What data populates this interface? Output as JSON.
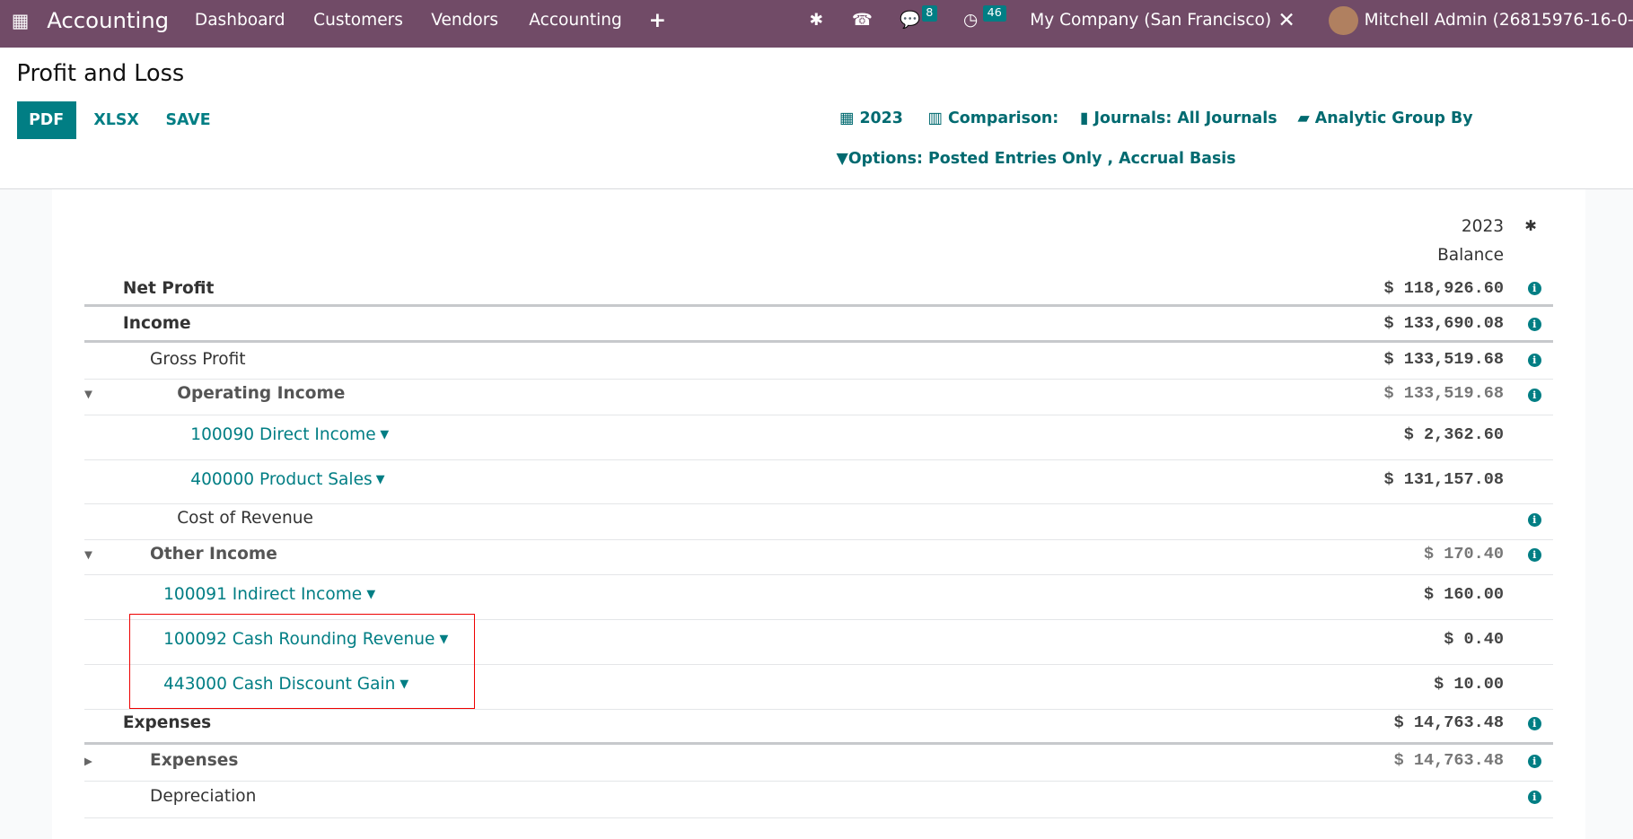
{
  "navbar": {
    "app_name": "Accounting",
    "menu": [
      "Dashboard",
      "Customers",
      "Vendors",
      "Accounting"
    ],
    "plus": "+",
    "messages_count": "8",
    "activities_count": "46",
    "company": "My Company (San Francisco)",
    "user": "Mitchell Admin (26815976-16-0-al"
  },
  "control_panel": {
    "title": "Profit and Loss",
    "buttons": {
      "pdf": "PDF",
      "xlsx": "XLSX",
      "save": "SAVE"
    },
    "filters": {
      "date": "2023",
      "comparison": "Comparison:",
      "journals": "Journals: All Journals",
      "analytic": "Analytic Group By",
      "options": "Options: Posted Entries Only , Accrual Basis"
    }
  },
  "report": {
    "column_year": "2023",
    "column_label": "Balance",
    "rows": [
      {
        "label": "Net Profit",
        "amount": "$ 118,926.60"
      },
      {
        "label": "Income",
        "amount": "$ 133,690.08"
      },
      {
        "label": "Gross Profit",
        "amount": "$ 133,519.68"
      },
      {
        "label": "Operating Income",
        "amount": "$ 133,519.68"
      },
      {
        "label": "100090 Direct Income",
        "amount": "$ 2,362.60"
      },
      {
        "label": "400000 Product Sales",
        "amount": "$ 131,157.08"
      },
      {
        "label": "Cost of Revenue",
        "amount": ""
      },
      {
        "label": "Other Income",
        "amount": "$ 170.40"
      },
      {
        "label": "100091 Indirect Income",
        "amount": "$ 160.00"
      },
      {
        "label": "100092 Cash Rounding Revenue",
        "amount": "$ 0.40"
      },
      {
        "label": "443000 Cash Discount Gain",
        "amount": "$ 10.00"
      },
      {
        "label": "Expenses",
        "amount": "$ 14,763.48"
      },
      {
        "label": "Expenses",
        "amount": "$ 14,763.48"
      },
      {
        "label": "Depreciation",
        "amount": ""
      }
    ]
  },
  "colors": {
    "navbar": "#714b67",
    "accent": "#017e84",
    "highlight_box": "#e00000"
  }
}
